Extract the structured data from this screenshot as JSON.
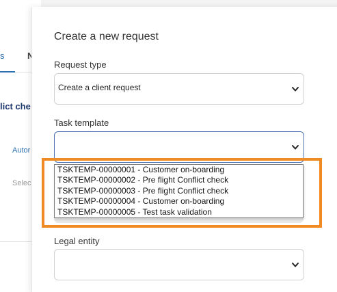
{
  "background": {
    "tab_1": "s",
    "tab_2": "N",
    "heading": "lict che",
    "link": "Autor",
    "muted": "Selec"
  },
  "panel": {
    "title": "Create a new request",
    "request_type": {
      "label": "Request type",
      "value": "Create a client request"
    },
    "task_template": {
      "label": "Task template",
      "value": "",
      "options": [
        "TSKTEMP-00000001 - Customer on-boarding",
        "TSKTEMP-00000002 - Pre flight Conflict check",
        "TSKTEMP-00000003 - Pre flight Conflict check",
        "TSKTEMP-00000004 - Customer on-boarding",
        "TSKTEMP-00000005 - Test task validation"
      ]
    },
    "legal_entity": {
      "label": "Legal entity",
      "value": ""
    }
  },
  "colors": {
    "highlight": "#f08a24",
    "focus_border": "#4a6fb5",
    "link": "#2a6fb0"
  }
}
